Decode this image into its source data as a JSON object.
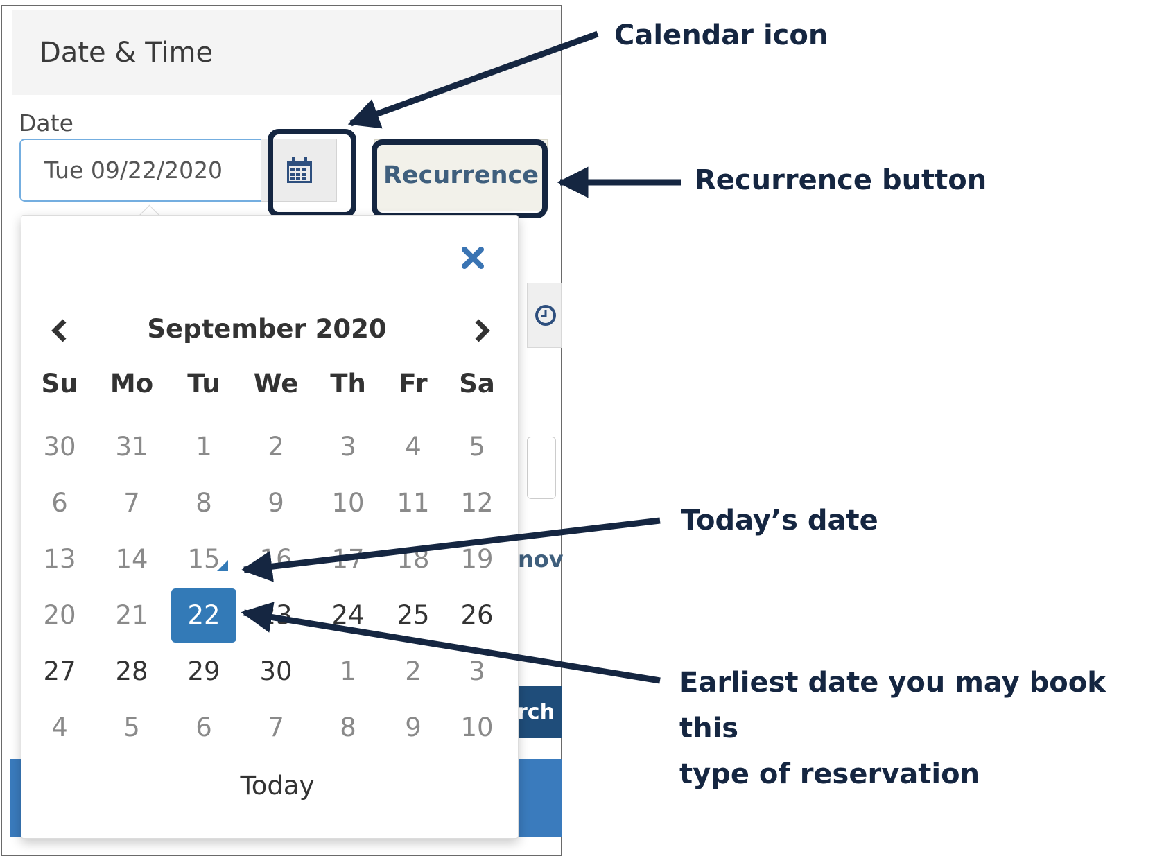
{
  "section": {
    "title": "Date & Time"
  },
  "date_field": {
    "label": "Date",
    "value": "Tue 09/22/2020"
  },
  "calendar_button": {
    "icon": "calendar-icon"
  },
  "recurrence_button": {
    "label": "Recurrence"
  },
  "background_fragments": {
    "nov_text": "nov",
    "search_text": "rch"
  },
  "datepicker": {
    "month_title": "September 2020",
    "weekdays": [
      "Su",
      "Mo",
      "Tu",
      "We",
      "Th",
      "Fr",
      "Sa"
    ],
    "weeks": [
      [
        "30",
        "31",
        "1",
        "2",
        "3",
        "4",
        "5"
      ],
      [
        "6",
        "7",
        "8",
        "9",
        "10",
        "11",
        "12"
      ],
      [
        "13",
        "14",
        "15",
        "16",
        "17",
        "18",
        "19"
      ],
      [
        "20",
        "21",
        "22",
        "23",
        "24",
        "25",
        "26"
      ],
      [
        "27",
        "28",
        "29",
        "30",
        "1",
        "2",
        "3"
      ],
      [
        "4",
        "5",
        "6",
        "7",
        "8",
        "9",
        "10"
      ]
    ],
    "today_button": "Today",
    "selected_date": "22",
    "today_date": "15",
    "colors": {
      "selected": "#337ab7",
      "accent": "#337ab7"
    }
  },
  "annotations": {
    "calendar_icon": "Calendar icon",
    "recurrence_button": "Recurrence button",
    "todays_date": "Today’s date",
    "earliest_line1": "Earliest date you may book this",
    "earliest_line2": "type of reservation",
    "color": "#152641"
  }
}
